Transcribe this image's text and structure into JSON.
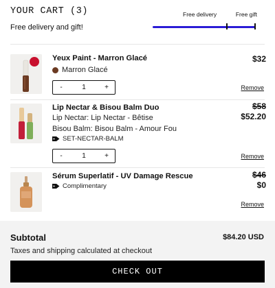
{
  "cart": {
    "title": "YOUR CART (3)",
    "promo": "Free delivery and gift!",
    "progress": {
      "milestones": [
        "Free delivery",
        "Free gift"
      ],
      "fraction": 1.0,
      "bar_color": "#2a1bd6"
    }
  },
  "items": [
    {
      "name": "Yeux Paint - Marron Glacé",
      "variant": "Marron Glacé",
      "swatch_color": "#6b3a22",
      "price": "$32",
      "quantity": "1",
      "remove_label": "Remove",
      "minus": "-",
      "plus": "+"
    },
    {
      "name": "Lip Nectar & Bisou Balm Duo",
      "line1": "Lip Nectar: Lip Nectar - Bêtise",
      "line2": "Bisou Balm: Bisou Balm - Amour Fou",
      "sku": "SET-NECTAR-BALM",
      "original_price": "$58",
      "price": "$52.20",
      "quantity": "1",
      "remove_label": "Remove",
      "minus": "-",
      "plus": "+"
    },
    {
      "name": "Sérum Superlatif - UV Damage Rescue",
      "note": "Complimentary",
      "original_price": "$46",
      "price": "$0",
      "remove_label": "Remove"
    }
  ],
  "summary": {
    "subtotal_label": "Subtotal",
    "subtotal_value": "$84.20 USD",
    "tax_note": "Taxes and shipping calculated at checkout",
    "checkout_label": "CHECK OUT"
  }
}
